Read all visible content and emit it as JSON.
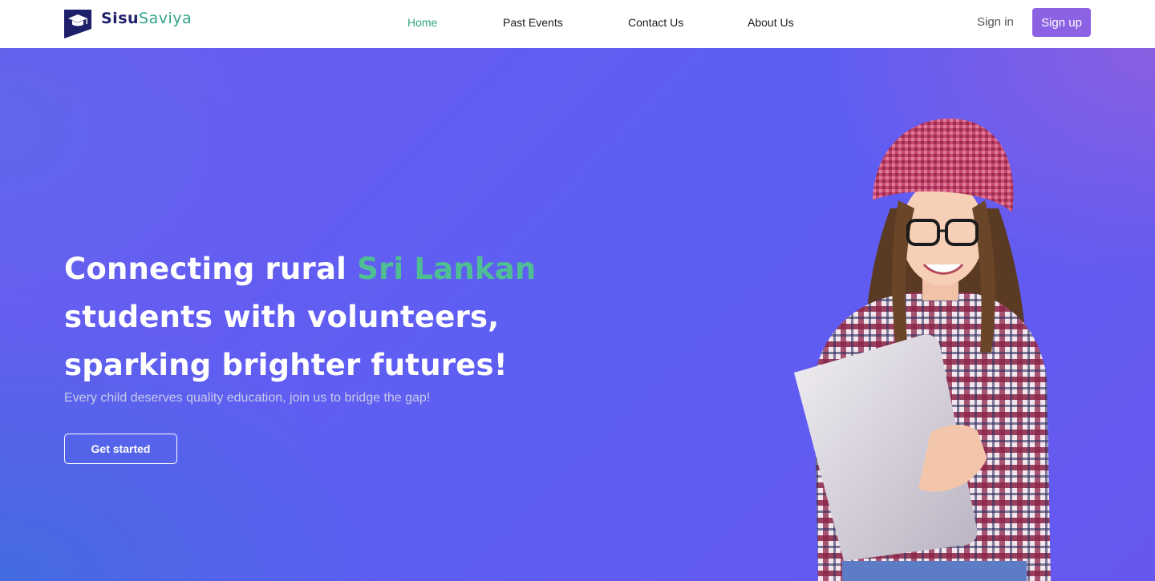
{
  "brand": {
    "part1": "Sisu",
    "part2": "Saviya"
  },
  "nav": {
    "items": [
      {
        "label": "Home",
        "active": true
      },
      {
        "label": "Past Events",
        "active": false
      },
      {
        "label": "Contact Us",
        "active": false
      },
      {
        "label": "About Us",
        "active": false
      }
    ]
  },
  "auth": {
    "sign_in": "Sign in",
    "sign_up": "Sign up"
  },
  "hero": {
    "headline_part1": "Connecting rural ",
    "headline_accent": "Sri Lankan",
    "headline_part2": " students with volunteers, sparking brighter futures!",
    "subheadline": "Every child deserves quality education, join us to bridge the gap!",
    "cta_label": "Get started",
    "image_icon": "student-with-laptop-illustration"
  },
  "colors": {
    "accent_green": "#2fa585",
    "brand_navy": "#1e1f6b",
    "signup_purple": "#8a62e3",
    "hero_purple": "#5d5ef3"
  }
}
